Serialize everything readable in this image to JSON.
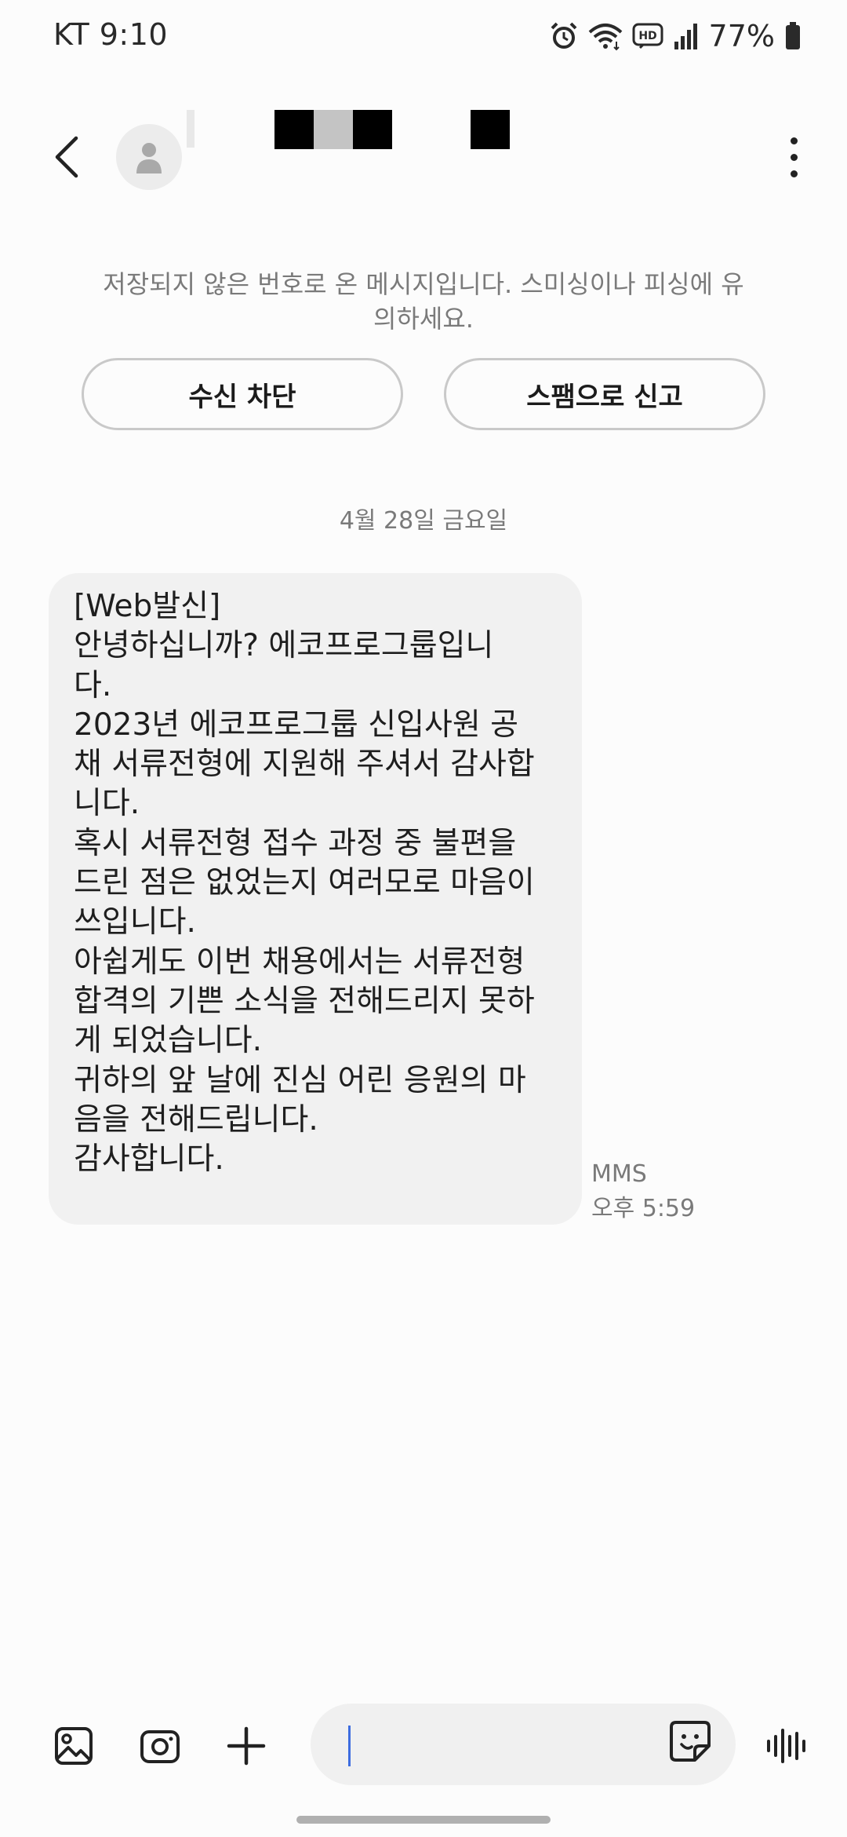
{
  "status_bar": {
    "carrier_time": "KT 9:10",
    "battery": "77%",
    "icons": [
      "alarm-icon",
      "wifi-icon",
      "hd-icon",
      "signal-icon",
      "battery-icon"
    ]
  },
  "header": {
    "icons": [
      "back-arrow-icon",
      "avatar-icon",
      "more-vert-icon"
    ],
    "redacted": true
  },
  "warning": {
    "line1": "저장되지 않은 번호로 온 메시지입니다. 스미싱이나 피싱에 유",
    "line2": "의하세요.",
    "block_label": "수신 차단",
    "spam_label": "스팸으로 신고"
  },
  "date_label": "4월 28일 금요일",
  "message": {
    "lines": [
      "[Web발신]",
      "안녕하십니까? 에코프로그룹입니",
      "다.",
      "2023년 에코프로그룹 신입사원 공",
      "채 서류전형에 지원해 주셔서 감사합",
      "니다.",
      "혹시 서류전형 접수 과정 중 불편을",
      "드린 점은 없었는지 여러모로 마음이",
      "쓰입니다.",
      "아쉽게도 이번 채용에서는 서류전형",
      "합격의 기쁜 소식을 전해드리지 못하",
      "게 되었습니다.",
      "귀하의 앞 날에 진심 어린 응원의 마",
      "음을 전해드립니다.",
      "감사합니다."
    ],
    "type": "MMS",
    "time": "오후 5:59"
  },
  "input": {
    "placeholder": "",
    "icons": [
      "gallery-icon",
      "camera-icon",
      "plus-icon",
      "sticker-icon",
      "voice-icon"
    ]
  },
  "colors": {
    "background": "#fcfcfc",
    "bubble": "#f1f1f1",
    "secondary_text": "#7a7a7a",
    "caret": "#3d6de0"
  }
}
